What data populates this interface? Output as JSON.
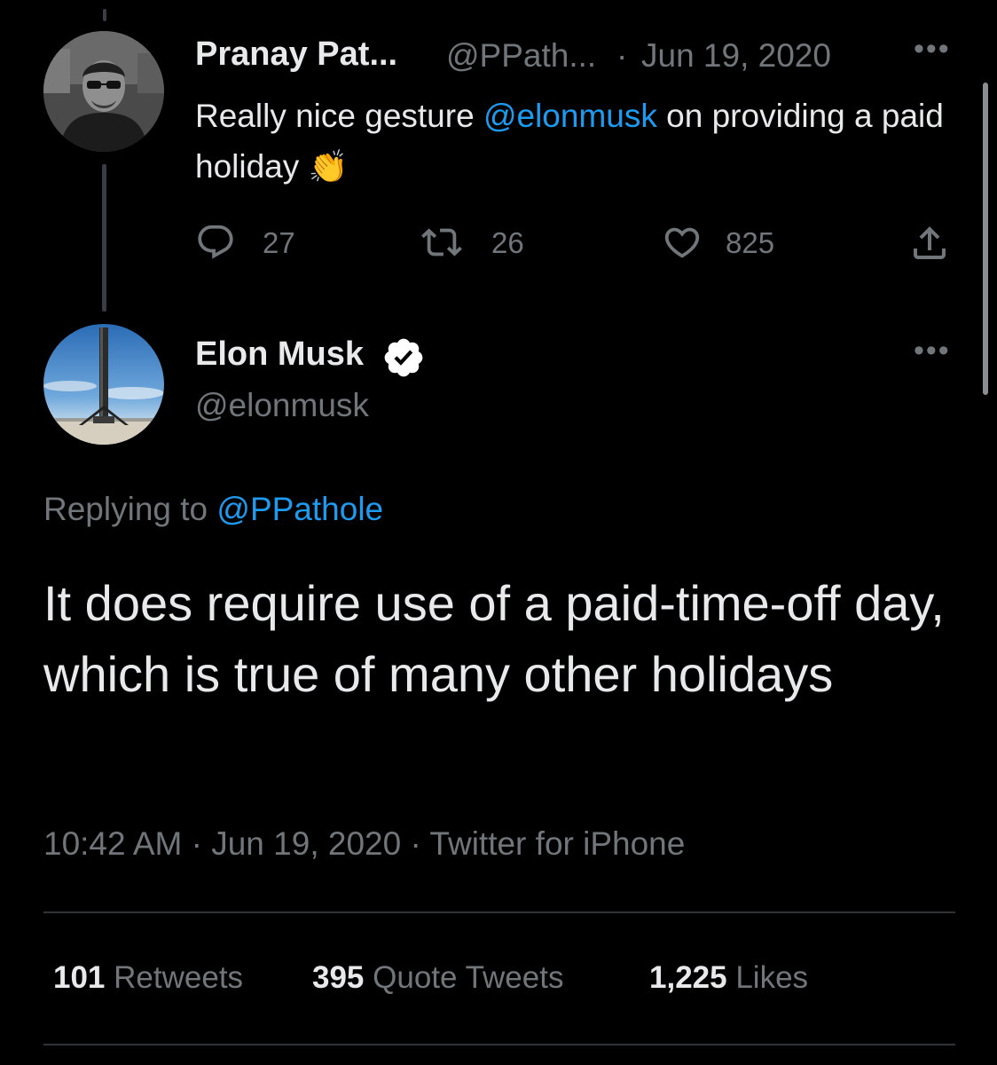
{
  "parent_tweet": {
    "author_name": "Pranay Pat...",
    "author_handle": "@PPath...",
    "separator": "·",
    "date": "Jun 19, 2020",
    "text_before": "Really nice gesture ",
    "mention": "@elonmusk",
    "text_after": " on providing a paid holiday",
    "emoji": "👏",
    "replies": "27",
    "retweets": "26",
    "likes": "825",
    "avatar_icon": "person-avatar-icon"
  },
  "main_tweet": {
    "author_name": "Elon Musk",
    "author_handle": "@elonmusk",
    "verified_icon": "verified-badge-icon",
    "replying_prefix": "Replying to ",
    "replying_to": "@PPathole",
    "text": "It does require use of a paid-time-off day, which is true of many other holidays",
    "time": "10:42 AM",
    "meta_sep1": " · ",
    "date": "Jun 19, 2020",
    "meta_sep2": " · ",
    "source": "Twitter for iPhone",
    "avatar_icon": "rocket-avatar-icon"
  },
  "stats": {
    "retweets_count": "101",
    "retweets_label": "Retweets",
    "quotes_count": "395",
    "quotes_label": "Quote Tweets",
    "likes_count": "1,225",
    "likes_label": "Likes"
  },
  "colors": {
    "background": "#000000",
    "text": "#e7e9ea",
    "secondary": "#71767b",
    "accent": "#1d9bf0",
    "divider": "#2f3336"
  }
}
